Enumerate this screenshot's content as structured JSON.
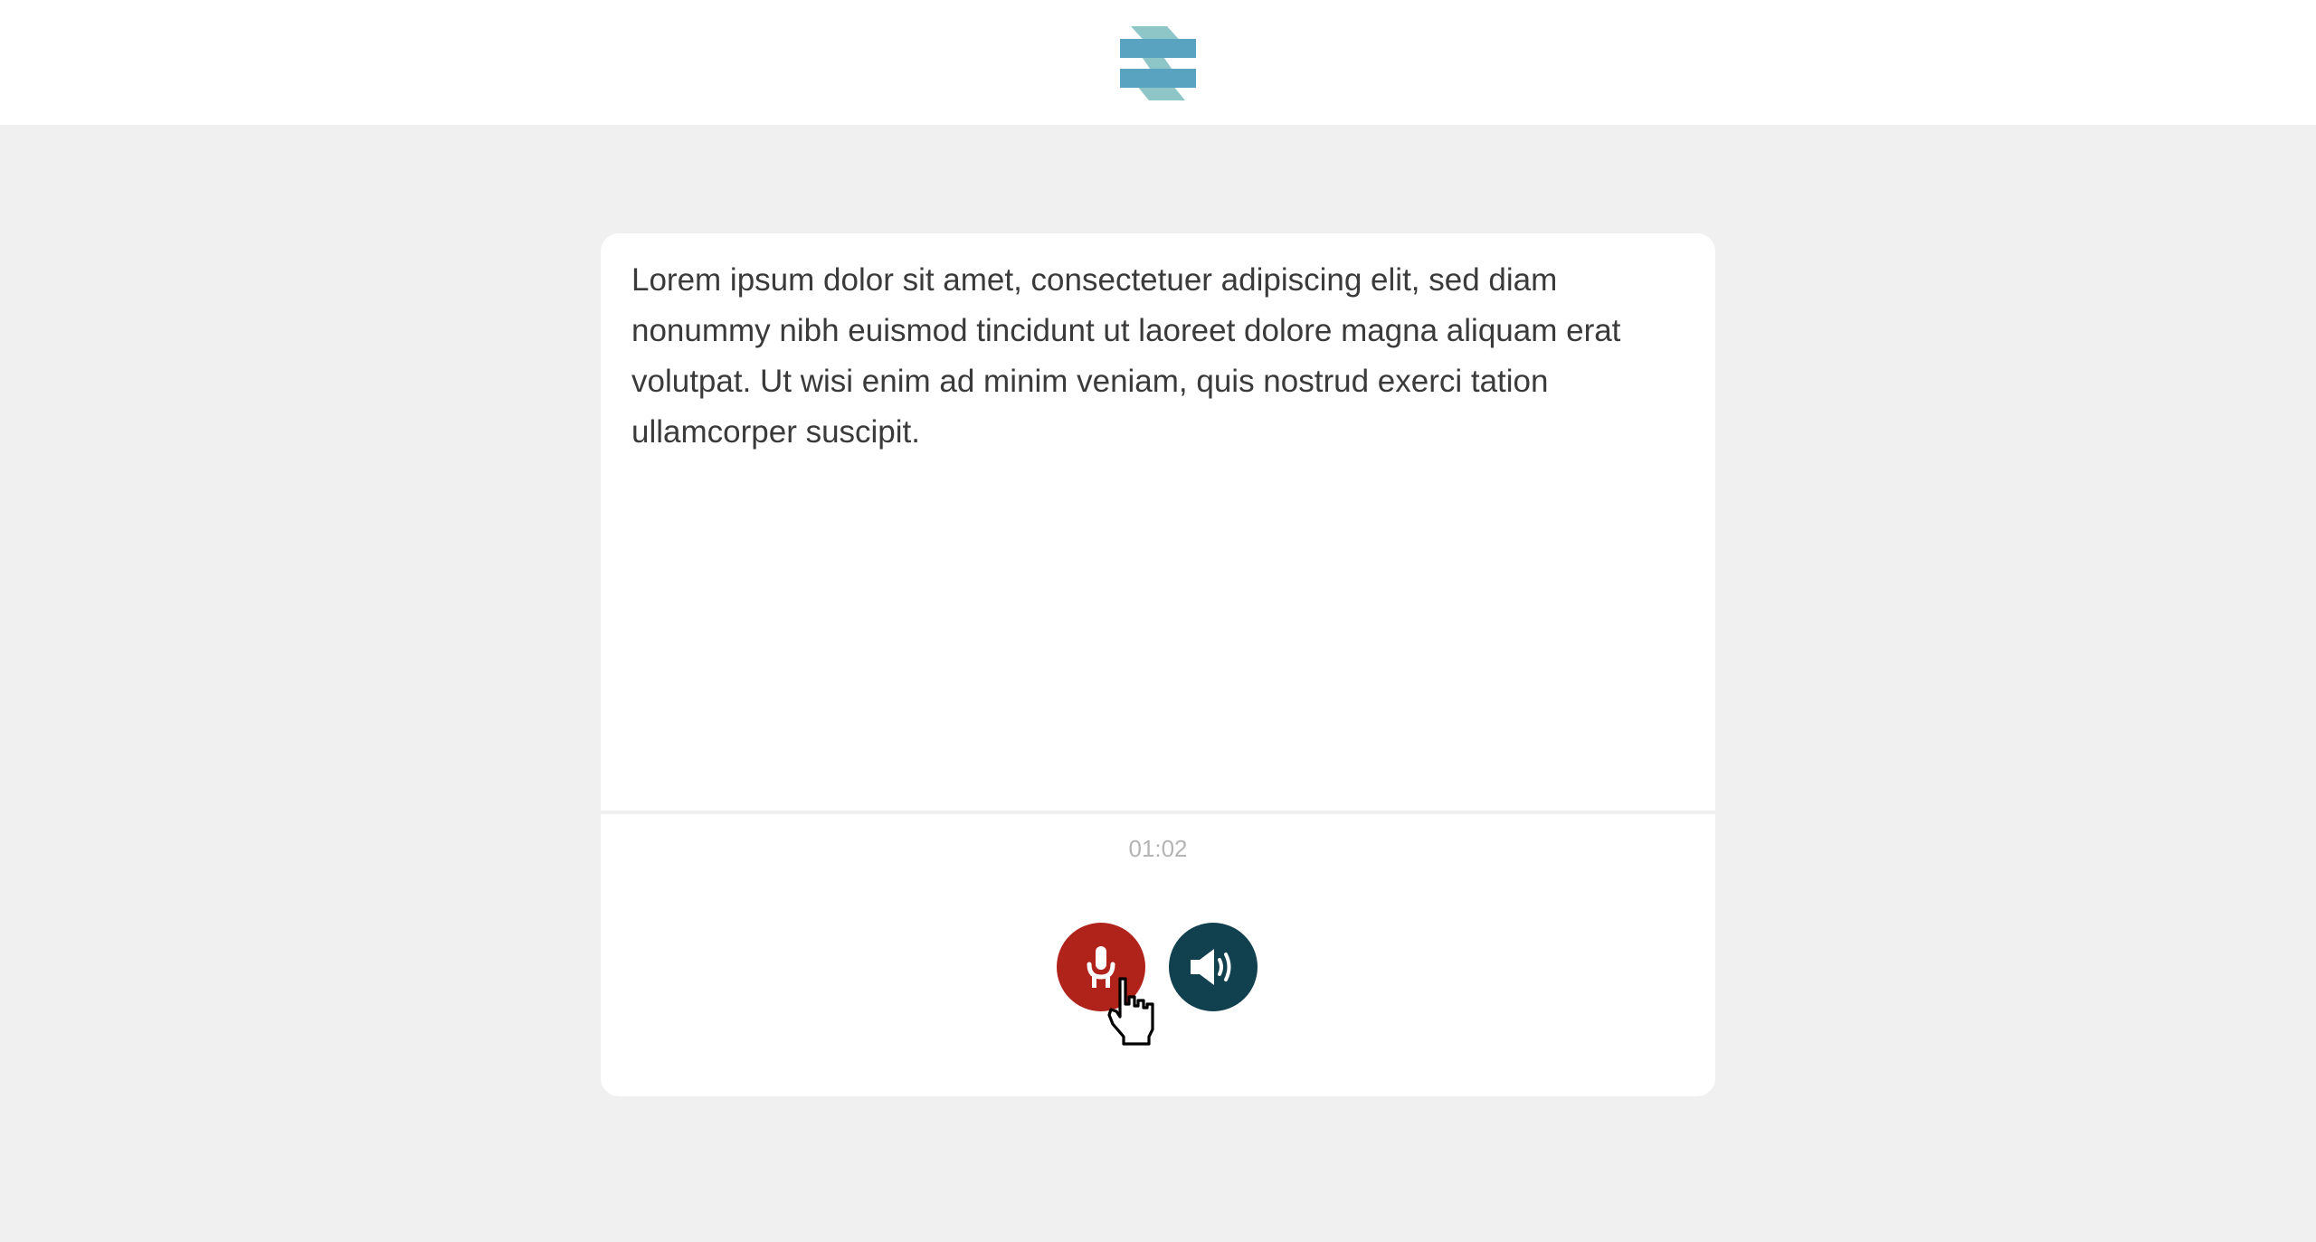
{
  "header": {
    "logo": "brand-logo",
    "logo_colors": [
      "#5aa3c0",
      "#8ec6c8"
    ]
  },
  "card": {
    "passage": "Lorem ipsum dolor sit amet, consectetuer adipiscing elit, sed diam nonummy nibh euismod tincidunt ut laoreet dolore magna aliquam erat volutpat. Ut wisi enim ad minim veniam, quis nostrud exerci tation ullamcorper suscipit.",
    "timer": "01:02"
  },
  "controls": {
    "record_icon": "microphone-icon",
    "record_color": "#b0231b",
    "play_icon": "speaker-icon",
    "play_color": "#11404f"
  },
  "pointer": "hand-pointer-cursor"
}
